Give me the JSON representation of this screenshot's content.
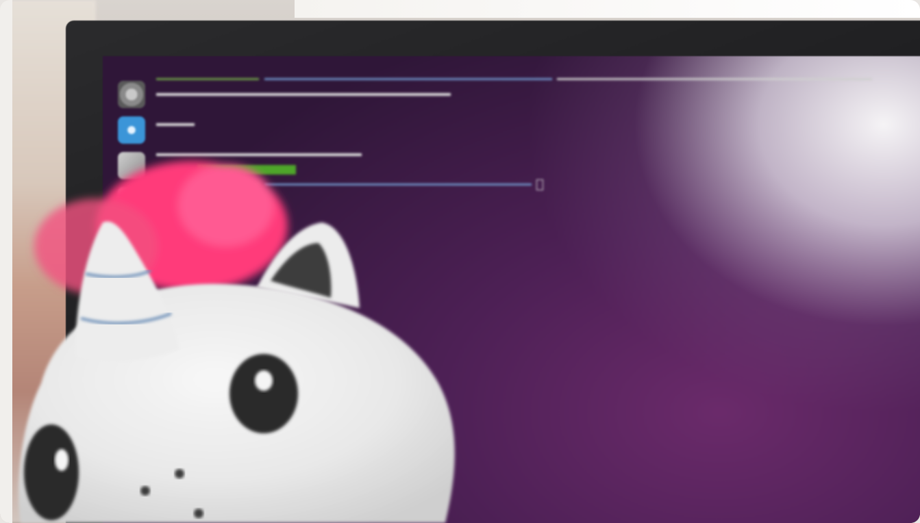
{
  "photo": {
    "description_hidden": "",
    "terminal": {
      "line1_user": "",
      "line1_path": "",
      "line1_cmd": "",
      "line2": "",
      "line3": "",
      "line4": "",
      "line5_ok": "",
      "line6_user": "",
      "line6_path": ""
    },
    "launcher_icons": [
      "settings-icon",
      "app-icon",
      "app-icon",
      "app-icon"
    ],
    "colors": {
      "desktop_purple": "#5a2359",
      "terminal_green": "#8ae234",
      "terminal_blue": "#729fcf",
      "plush_white": "#eeeeee",
      "plush_pink_hair": "#ff3e7f"
    }
  }
}
